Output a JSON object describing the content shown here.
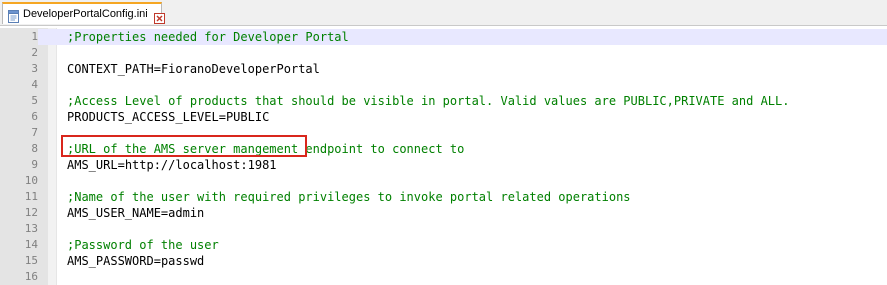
{
  "tab": {
    "title": "DeveloperPortalConfig.ini",
    "file_icon": "ini-file-icon",
    "close_icon": "close-icon"
  },
  "colors": {
    "comment": "#008000",
    "highlight_border": "#d9261c",
    "current_line": "#e8e8ff",
    "gutter": "#e4e4e4"
  },
  "editor": {
    "current_line": 1,
    "highlighted_line": 6,
    "lines": [
      {
        "num": "1",
        "type": "comment",
        "text": ";Properties needed for Developer Portal"
      },
      {
        "num": "2",
        "type": "blank",
        "text": ""
      },
      {
        "num": "3",
        "type": "kv",
        "key": "CONTEXT_PATH",
        "value": "FioranoDeveloperPortal"
      },
      {
        "num": "4",
        "type": "blank",
        "text": ""
      },
      {
        "num": "5",
        "type": "comment",
        "text": ";Access Level of products that should be visible in portal. Valid values are PUBLIC,PRIVATE and ALL."
      },
      {
        "num": "6",
        "type": "kv",
        "key": "PRODUCTS_ACCESS_LEVEL",
        "value": "PUBLIC"
      },
      {
        "num": "7",
        "type": "blank",
        "text": ""
      },
      {
        "num": "8",
        "type": "comment",
        "text": ";URL of the AMS server mangement endpoint to connect to"
      },
      {
        "num": "9",
        "type": "kv",
        "key": "AMS_URL",
        "value": "http://localhost:1981"
      },
      {
        "num": "10",
        "type": "blank",
        "text": ""
      },
      {
        "num": "11",
        "type": "comment",
        "text": ";Name of the user with required privileges to invoke portal related operations"
      },
      {
        "num": "12",
        "type": "kv",
        "key": "AMS_USER_NAME",
        "value": "admin"
      },
      {
        "num": "13",
        "type": "blank",
        "text": ""
      },
      {
        "num": "14",
        "type": "comment",
        "text": ";Password of the user"
      },
      {
        "num": "15",
        "type": "kv",
        "key": "AMS_PASSWORD",
        "value": "passwd"
      },
      {
        "num": "16",
        "type": "blank",
        "text": ""
      }
    ]
  }
}
